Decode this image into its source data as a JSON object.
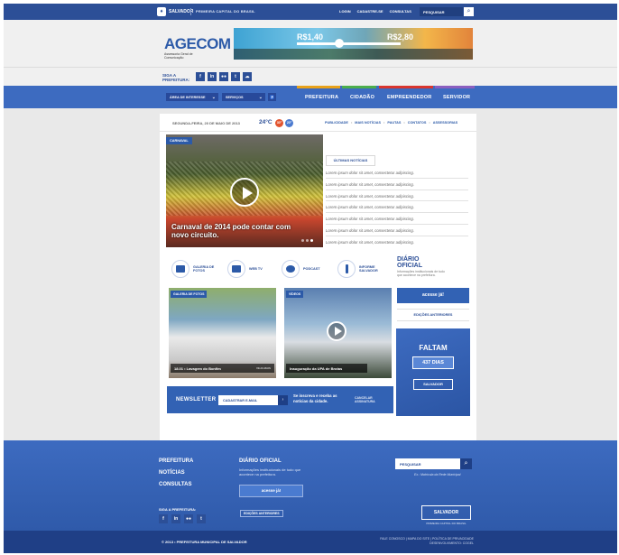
{
  "topbar": {
    "logo_text": "SALVADOR",
    "capital": "PRIMEIRA CAPITAL DO BRASIL",
    "links": [
      "LOGIN",
      "CADASTRE-SE",
      "CONSULTAS"
    ],
    "search_placeholder": "PESQUISAR",
    "brand_color": "#2c4f97"
  },
  "brand": {
    "name": "AGECOM",
    "subtitle": "Assessoria Geral de Comunicação",
    "banner_price_1": "R$1,40",
    "banner_price_2": "R$2,80"
  },
  "social": {
    "label": "SIGA A PREFEITURA:",
    "icons": [
      "f",
      "in",
      "●●",
      "t",
      "☁"
    ]
  },
  "nav": {
    "dropdowns": [
      "ÁREA DE INTERESSE",
      "SERVIÇOS"
    ],
    "items": [
      {
        "label": "PREFEITURA",
        "accent": "#e9a21b"
      },
      {
        "label": "CIDADÃO",
        "accent": "#4cae4c"
      },
      {
        "label": "EMPREENDEDOR",
        "accent": "#d9362f"
      },
      {
        "label": "SERVIDOR",
        "accent": "#8b5fbf"
      }
    ]
  },
  "infobar": {
    "date": "SEGUNDA-FEIRA, 20 DE MAIO DE 2013",
    "temperature": "24°C",
    "badge_1": "30°",
    "badge_2": "20°",
    "links": [
      "PUBLICIDADE",
      "MAIS NOTÍCIAS",
      "PAUTAS",
      "CONTATOS",
      "ASSESSORIAS"
    ]
  },
  "hero": {
    "tag": "CARNAVAL",
    "caption": "Carnaval de 2014 pode contar com novo circuito."
  },
  "news": {
    "heading": "ÚLTIMAS NOTÍCIAS",
    "items": [
      "Lorem ipsum dolor sit amet, consectetur adipiscing.",
      "Lorem ipsum dolor sit amet, consectetur adipiscing.",
      "Lorem ipsum dolor sit amet, consectetur adipiscing.",
      "Lorem ipsum dolor sit amet, consectetur adipiscing.",
      "Lorem ipsum dolor sit amet, consectetur adipiscing.",
      "Lorem ipsum dolor sit amet, consectetur adipiscing.",
      "Lorem ipsum dolor sit amet, consectetur adipiscing.",
      "Lorem ipsum dolor sit amet, consectetur adipiscing."
    ]
  },
  "shortcuts": [
    {
      "label": "GALERIA DE FOTOS"
    },
    {
      "label": "WEB TV"
    },
    {
      "label": "PODCAST"
    },
    {
      "label": "INFORME SALVADOR"
    }
  ],
  "diario": {
    "title": "DIÁRIO OFICIAL",
    "desc": "Informações institucionais de tudo que acontece na prefeitura.",
    "button": "acesse já!",
    "previous": "EDIÇÕES ANTERIORES"
  },
  "gallery": {
    "photo_tag": "GALERIA DE FOTOS",
    "photo_caption": "18.01 • Lavagem do Bonfim",
    "photo_more": "VEJA MAIS",
    "video_tag": "VÍDEOS",
    "video_caption": "Inauguração da UPA de Brotas"
  },
  "faltam": {
    "title": "FALTAM",
    "days": "437 DIAS",
    "logo": "SALVADOR"
  },
  "newsletter": {
    "title": "NEWSLETTER",
    "input": "CADASTRAR E-MAIL",
    "desc": "Se inscreva e receba as notícias da cidade.",
    "cancel": "CANCELAR ASSINATURA"
  },
  "footer": {
    "links": [
      "PREFEITURA",
      "NOTÍCIAS",
      "CONSULTAS"
    ],
    "diario_title": "DIÁRIO OFICIAL",
    "diario_desc": "Informações institucionais de tudo que acontece na prefeitura.",
    "diario_button": "acesse já!",
    "diario_previous": "EDIÇÕES ANTERIORES",
    "follow": "SIGA A PREFEITURA:",
    "icons": [
      "f",
      "in",
      "●●",
      "t"
    ],
    "search_placeholder": "PESQUISAR",
    "search_note": "Ex.: Matrícula da Rede Municipal",
    "logo": "SALVADOR",
    "logo_caption": "PRIMEIRA CAPITAL DO BRASIL"
  },
  "bottom": {
    "copyright": "© 2013 • PREFEITURA MUNICIPAL DE SALVADOR",
    "links": "FALE CONOSCO | MAPA DO SITE | POLÍTICA DE PRIVACIDADE",
    "dev": "DESENVOLVIMENTO: COGEL"
  }
}
